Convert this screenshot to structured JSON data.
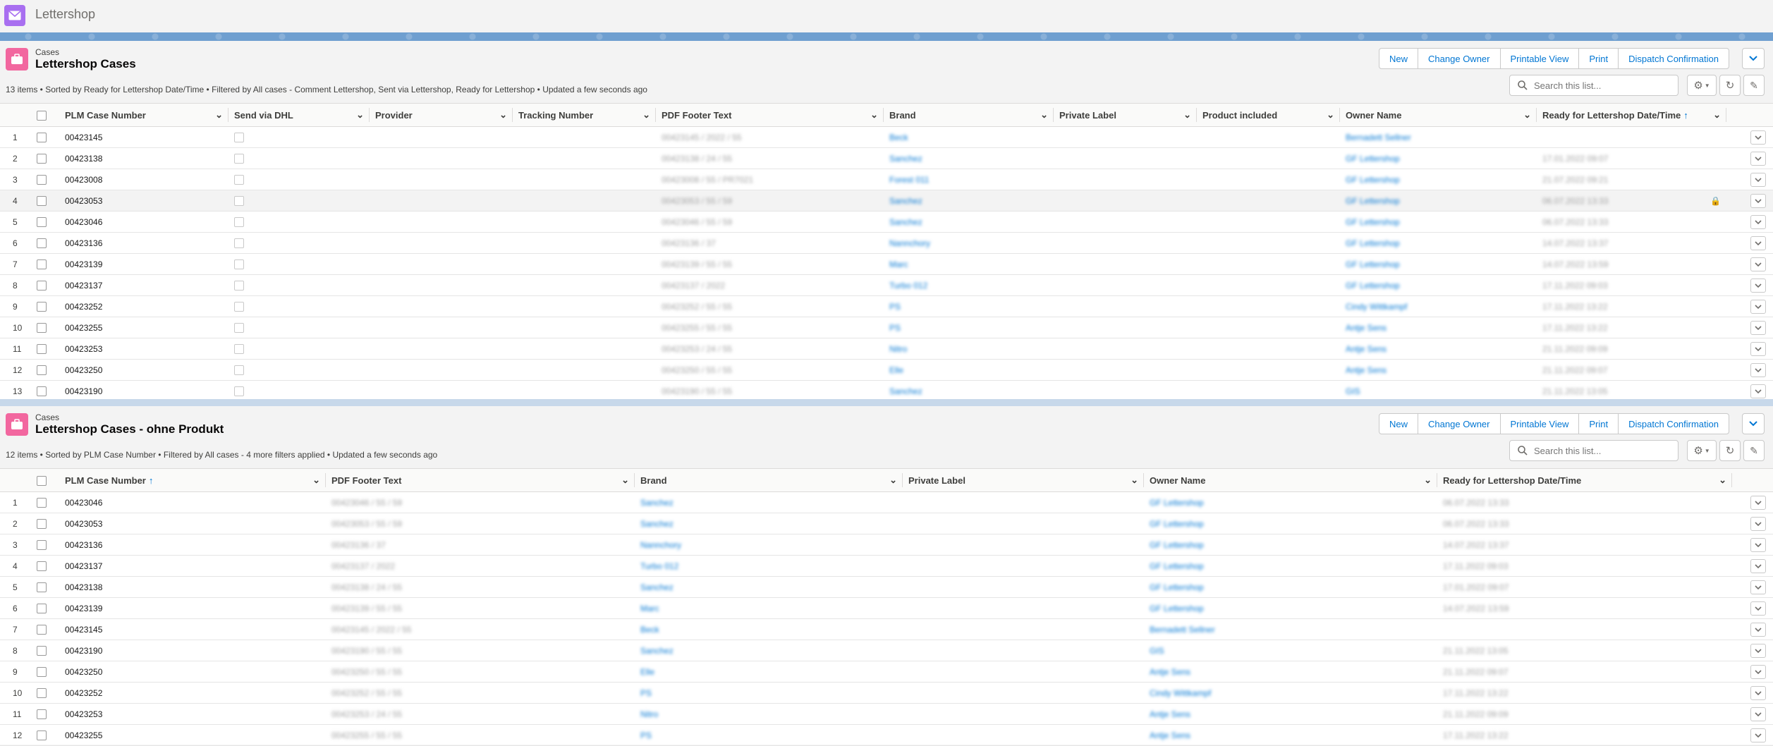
{
  "app": {
    "title": "Lettershop",
    "icon": "envelope-icon"
  },
  "colors": {
    "app_icon": "#a86ff0",
    "object_icon": "#f2679f",
    "link": "#0176d3"
  },
  "list1": {
    "object_label": "Cases",
    "title": "Lettershop Cases",
    "meta": "13 items • Sorted by Ready for Lettershop Date/Time • Filtered by All cases - Comment Lettershop, Sent via Lettershop, Ready for Lettershop • Updated a few seconds ago",
    "buttons": [
      "New",
      "Change Owner",
      "Printable View",
      "Print",
      "Dispatch Confirmation"
    ],
    "search_placeholder": "Search this list...",
    "columns": [
      "PLM Case Number",
      "Send via DHL",
      "Provider",
      "Tracking Number",
      "PDF Footer Text",
      "Brand",
      "Private Label",
      "Product included",
      "Owner Name",
      "Ready for Lettershop Date/Time"
    ],
    "rows": [
      {
        "n": "1",
        "case": "00423145",
        "footer": "00423145 / 2022 / 55",
        "brand": "Beck",
        "owner": "Bernadett Sellner",
        "date": ""
      },
      {
        "n": "2",
        "case": "00423138",
        "footer": "00423138 / 24 / 55",
        "brand": "Sanchez",
        "owner": "GF Lettershop",
        "date": "17.01.2022 09:07"
      },
      {
        "n": "3",
        "case": "00423008",
        "footer": "00423008 / 55 / PR7021",
        "brand": "Forest 011",
        "owner": "GF Lettershop",
        "date": "21.07.2022 09:21"
      },
      {
        "n": "4",
        "case": "00423053",
        "footer": "00423053 / 55 / 59",
        "brand": "Sanchez",
        "owner": "GF Lettershop",
        "date": "06.07.2022 13:33"
      },
      {
        "n": "5",
        "case": "00423046",
        "footer": "00423046 / 55 / 59",
        "brand": "Sanchez",
        "owner": "GF Lettershop",
        "date": "06.07.2022 13:33"
      },
      {
        "n": "6",
        "case": "00423136",
        "footer": "00423136 / 37",
        "brand": "Nannchory",
        "owner": "GF Lettershop",
        "date": "14.07.2022 13:37"
      },
      {
        "n": "7",
        "case": "00423139",
        "footer": "00423139 / 55 / 55",
        "brand": "Marc",
        "owner": "GF Lettershop",
        "date": "14.07.2022 13:59"
      },
      {
        "n": "8",
        "case": "00423137",
        "footer": "00423137 / 2022",
        "brand": "Turbo 012",
        "owner": "GF Lettershop",
        "date": "17.11.2022 09:03"
      },
      {
        "n": "9",
        "case": "00423252",
        "footer": "00423252 / 55 / 55",
        "brand": "PS",
        "owner": "Cindy Wittkampf",
        "date": "17.11.2022 13:22"
      },
      {
        "n": "10",
        "case": "00423255",
        "footer": "00423255 / 55 / 55",
        "brand": "PS",
        "owner": "Antje Sens",
        "date": "17.11.2022 13:22"
      },
      {
        "n": "11",
        "case": "00423253",
        "footer": "00423253 / 24 / 55",
        "brand": "Nitro",
        "owner": "Antje Sens",
        "date": "21.11.2022 09:09"
      },
      {
        "n": "12",
        "case": "00423250",
        "footer": "00423250 / 55 / 55",
        "brand": "Elle",
        "owner": "Antje Sens",
        "date": "21.11.2022 09:07"
      },
      {
        "n": "13",
        "case": "00423190",
        "footer": "00423190 / 55 / 55",
        "brand": "Sanchez",
        "owner": "GIS",
        "date": "21.11.2022 13:05"
      }
    ]
  },
  "list2": {
    "object_label": "Cases",
    "title": "Lettershop Cases - ohne Produkt",
    "meta": "12 items • Sorted by PLM Case Number • Filtered by All cases - 4 more filters applied • Updated a few seconds ago",
    "buttons": [
      "New",
      "Change Owner",
      "Printable View",
      "Print",
      "Dispatch Confirmation"
    ],
    "search_placeholder": "Search this list...",
    "columns": [
      "PLM Case Number",
      "PDF Footer Text",
      "Brand",
      "Private Label",
      "Owner Name",
      "Ready for Lettershop Date/Time"
    ],
    "rows": [
      {
        "n": "1",
        "case": "00423046",
        "footer": "00423046 / 55 / 59",
        "brand": "Sanchez",
        "owner": "GF Lettershop",
        "date": "06.07.2022 13:33"
      },
      {
        "n": "2",
        "case": "00423053",
        "footer": "00423053 / 55 / 59",
        "brand": "Sanchez",
        "owner": "GF Lettershop",
        "date": "06.07.2022 13:33"
      },
      {
        "n": "3",
        "case": "00423136",
        "footer": "00423136 / 37",
        "brand": "Nannchory",
        "owner": "GF Lettershop",
        "date": "14.07.2022 13:37"
      },
      {
        "n": "4",
        "case": "00423137",
        "footer": "00423137 / 2022",
        "brand": "Turbo 012",
        "owner": "GF Lettershop",
        "date": "17.11.2022 09:03"
      },
      {
        "n": "5",
        "case": "00423138",
        "footer": "00423138 / 24 / 55",
        "brand": "Sanchez",
        "owner": "GF Lettershop",
        "date": "17.01.2022 09:07"
      },
      {
        "n": "6",
        "case": "00423139",
        "footer": "00423139 / 55 / 55",
        "brand": "Marc",
        "owner": "GF Lettershop",
        "date": "14.07.2022 13:59"
      },
      {
        "n": "7",
        "case": "00423145",
        "footer": "00423145 / 2022 / 55",
        "brand": "Beck",
        "owner": "Bernadett Sellner",
        "date": ""
      },
      {
        "n": "8",
        "case": "00423190",
        "footer": "00423190 / 55 / 55",
        "brand": "Sanchez",
        "owner": "GIS",
        "date": "21.11.2022 13:05"
      },
      {
        "n": "9",
        "case": "00423250",
        "footer": "00423250 / 55 / 55",
        "brand": "Elle",
        "owner": "Antje Sens",
        "date": "21.11.2022 09:07"
      },
      {
        "n": "10",
        "case": "00423252",
        "footer": "00423252 / 55 / 55",
        "brand": "PS",
        "owner": "Cindy Wittkampf",
        "date": "17.11.2022 13:22"
      },
      {
        "n": "11",
        "case": "00423253",
        "footer": "00423253 / 24 / 55",
        "brand": "Nitro",
        "owner": "Antje Sens",
        "date": "21.11.2022 09:09"
      },
      {
        "n": "12",
        "case": "00423255",
        "footer": "00423255 / 55 / 55",
        "brand": "PS",
        "owner": "Antje Sens",
        "date": "17.11.2022 13:22"
      }
    ]
  }
}
